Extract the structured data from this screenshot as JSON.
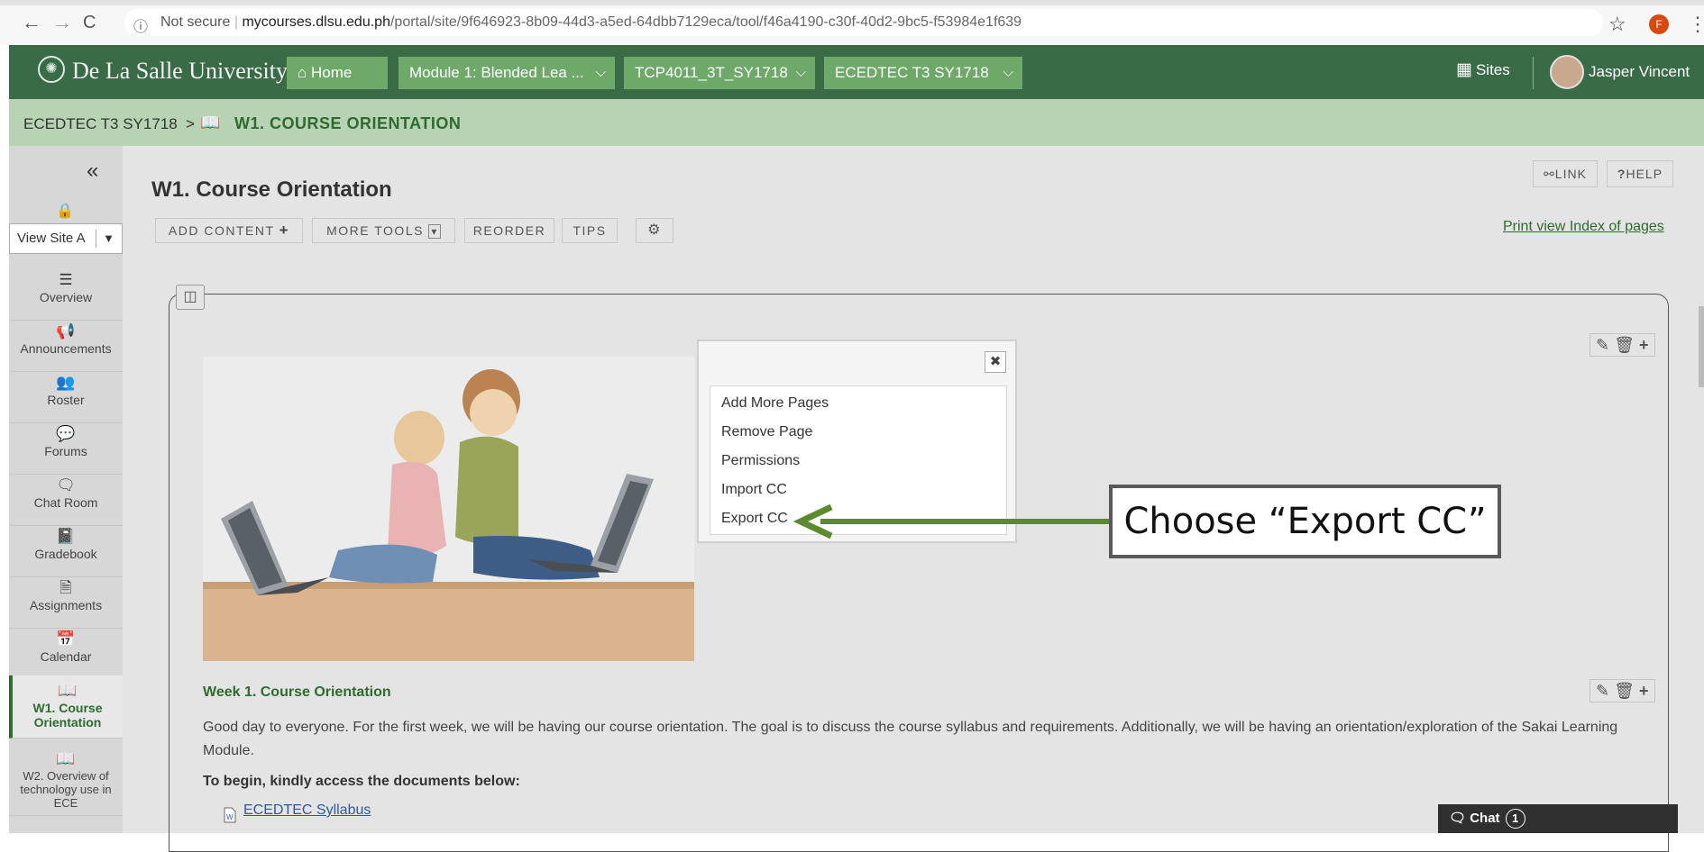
{
  "browser": {
    "back": "←",
    "forward": "→",
    "reload": "C",
    "security": "Not secure",
    "url_domain": "mycourses.dlsu.edu.ph",
    "url_path": "/portal/site/9f646923-8b09-44d3-a5ed-64dbb7129eca/tool/f46a4190-c30f-40d2-9bc5-f53984e1f639",
    "profile_letter": "F"
  },
  "header": {
    "brand": "De La Salle University",
    "home_label": "Home",
    "sites_dropdowns": [
      "Module 1: Blended Lea ...",
      "TCP4011_3T_SY1718",
      "ECEDTEC T3 SY1718"
    ],
    "sites_label": "Sites",
    "user_name": "Jasper Vincent"
  },
  "breadcrumb": {
    "site": "ECEDTEC T3 SY1718",
    "separator": ">",
    "page": "W1. COURSE ORIENTATION"
  },
  "sidebar": {
    "view_site_as": "View Site A",
    "items": [
      {
        "label": "Overview",
        "icon": "list-icon"
      },
      {
        "label": "Announcements",
        "icon": "megaphone-icon"
      },
      {
        "label": "Roster",
        "icon": "users-icon"
      },
      {
        "label": "Forums",
        "icon": "comments-icon"
      },
      {
        "label": "Chat Room",
        "icon": "chat-icon"
      },
      {
        "label": "Gradebook",
        "icon": "book-icon"
      },
      {
        "label": "Assignments",
        "icon": "file-icon"
      },
      {
        "label": "Calendar",
        "icon": "calendar-icon"
      },
      {
        "label": "W1. Course Orientation",
        "icon": "open-book-icon"
      },
      {
        "label": "W2. Overview of technology use in ECE",
        "icon": "open-book-icon"
      }
    ]
  },
  "main": {
    "title": "W1. Course Orientation",
    "toolbar": {
      "add_content": "ADD CONTENT",
      "more_tools": "MORE TOOLS",
      "reorder": "REORDER",
      "tips": "TIPS"
    },
    "link_label": "LINK",
    "help_label": "HELP",
    "print_view": "Print view",
    "index_of_pages": "Index of pages",
    "week_title": "Week 1. Course Orientation",
    "week_body": "Good day to everyone. For the first week, we will be having our course orientation. The goal is to discuss the course syllabus and requirements. Additionally, we will be having an orientation/exploration of the Sakai Learning Module.",
    "begin_text": "To begin, kindly access the documents below:",
    "syllabus_link": "ECEDTEC Syllabus"
  },
  "popup": {
    "items": [
      "Add More Pages",
      "Remove Page",
      "Permissions",
      "Import CC",
      "Export CC"
    ]
  },
  "callout": {
    "text": "Choose “Export CC”",
    "arrow_color": "#5c8a2e"
  },
  "chat": {
    "label": "Chat",
    "count": "1"
  },
  "colors": {
    "topnav": "#3a6b47",
    "nav_button": "#6ea96a",
    "breadcrumb_bar": "#b7d3b3",
    "accent_green": "#2f6a2f"
  }
}
